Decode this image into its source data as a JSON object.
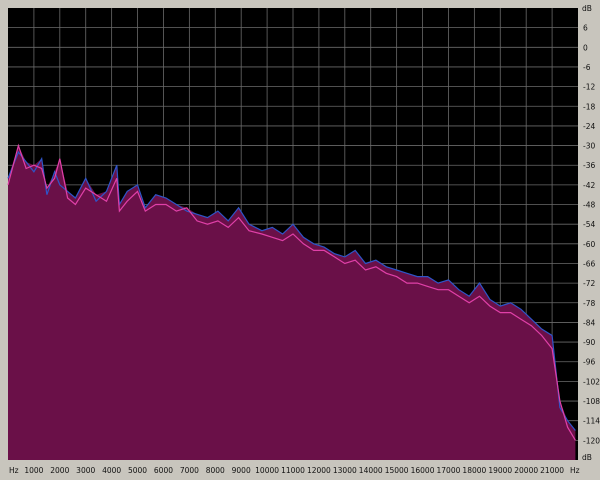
{
  "chart_data": {
    "type": "area",
    "title": "",
    "xlabel": "",
    "ylabel": "",
    "x_unit": "Hz",
    "y_unit": "dB",
    "x_ticks": [
      1000,
      2000,
      3000,
      4000,
      5000,
      6000,
      7000,
      8000,
      9000,
      10000,
      11000,
      12000,
      13000,
      14000,
      15000,
      16000,
      17000,
      18000,
      19000,
      20000,
      21000
    ],
    "y_ticks": [
      6,
      0,
      -6,
      -12,
      -18,
      -24,
      -30,
      -36,
      -42,
      -48,
      -54,
      -60,
      -66,
      -72,
      -78,
      -84,
      -90,
      -96,
      -102,
      -108,
      -114,
      -120
    ],
    "xlim": [
      0,
      22000
    ],
    "ylim": [
      -126,
      12
    ],
    "grid": true,
    "colors": {
      "background": "#000000",
      "grid": "#6a6a6a",
      "fill": "#6a1048",
      "channel_left": "#2f55c8",
      "channel_right": "#e040a8",
      "frame": "#c8c5bd"
    },
    "series": [
      {
        "channel": "left",
        "color": "#2f55c8",
        "x": [
          0,
          400,
          700,
          1000,
          1300,
          1500,
          1800,
          2000,
          2300,
          2600,
          3000,
          3400,
          3800,
          4200,
          4300,
          4600,
          5000,
          5300,
          5700,
          6100,
          6500,
          6900,
          7300,
          7700,
          8100,
          8500,
          8900,
          9300,
          9800,
          10200,
          10600,
          11000,
          11400,
          11800,
          12200,
          12600,
          13000,
          13400,
          13800,
          14200,
          14600,
          15000,
          15400,
          15800,
          16200,
          16600,
          17000,
          17400,
          17800,
          18200,
          18600,
          19000,
          19400,
          19800,
          20200,
          20600,
          21000,
          21300,
          21600,
          21900
        ],
        "y": [
          -40,
          -32,
          -35,
          -38,
          -34,
          -45,
          -38,
          -42,
          -44,
          -46,
          -40,
          -47,
          -44,
          -36,
          -48,
          -44,
          -42,
          -49,
          -45,
          -46,
          -48,
          -50,
          -51,
          -52,
          -50,
          -53,
          -49,
          -54,
          -56,
          -55,
          -57,
          -54,
          -58,
          -60,
          -61,
          -63,
          -64,
          -62,
          -66,
          -65,
          -67,
          -68,
          -69,
          -70,
          -70,
          -72,
          -71,
          -74,
          -76,
          -72,
          -77,
          -79,
          -78,
          -80,
          -83,
          -86,
          -88,
          -110,
          -114,
          -117
        ]
      },
      {
        "channel": "right",
        "color": "#e040a8",
        "x": [
          0,
          400,
          700,
          1000,
          1300,
          1500,
          1800,
          2000,
          2300,
          2600,
          3000,
          3400,
          3800,
          4200,
          4300,
          4600,
          5000,
          5300,
          5700,
          6100,
          6500,
          6900,
          7300,
          7700,
          8100,
          8500,
          8900,
          9300,
          9800,
          10200,
          10600,
          11000,
          11400,
          11800,
          12200,
          12600,
          13000,
          13400,
          13800,
          14200,
          14600,
          15000,
          15400,
          15800,
          16200,
          16600,
          17000,
          17400,
          17800,
          18200,
          18600,
          19000,
          19400,
          19800,
          20200,
          20600,
          21000,
          21300,
          21600,
          21900
        ],
        "y": [
          -42,
          -30,
          -37,
          -36,
          -37,
          -43,
          -40,
          -34,
          -46,
          -48,
          -43,
          -45,
          -47,
          -40,
          -50,
          -47,
          -44,
          -50,
          -48,
          -48,
          -50,
          -49,
          -53,
          -54,
          -53,
          -55,
          -52,
          -56,
          -57,
          -58,
          -59,
          -57,
          -60,
          -62,
          -62,
          -64,
          -66,
          -65,
          -68,
          -67,
          -69,
          -70,
          -72,
          -72,
          -73,
          -74,
          -74,
          -76,
          -78,
          -76,
          -79,
          -81,
          -81,
          -83,
          -85,
          -88,
          -92,
          -108,
          -116,
          -120
        ]
      }
    ]
  }
}
